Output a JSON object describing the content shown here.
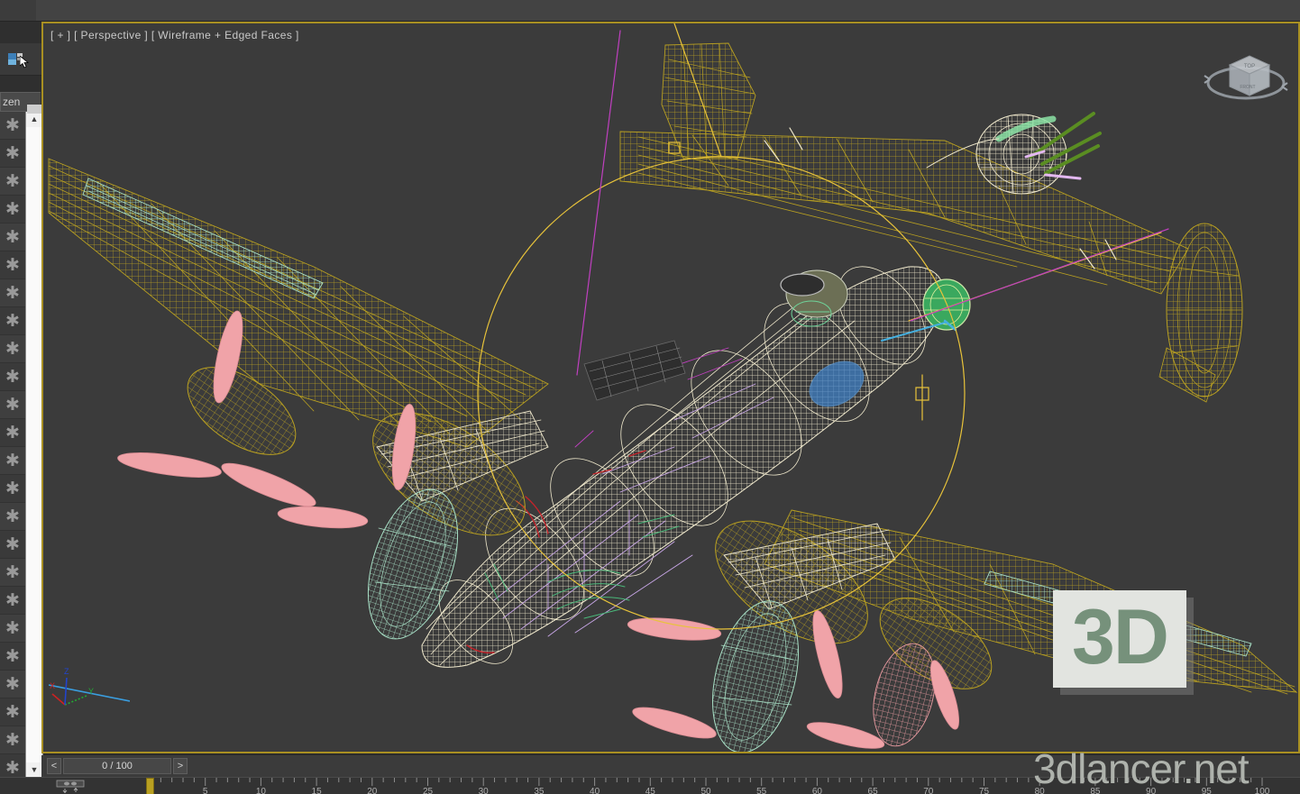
{
  "app": {
    "name": "3ds Max Viewport",
    "viewport_bg": "#3b3b3b",
    "active_border": "#a99022"
  },
  "viewport": {
    "label": "[ + ] [ Perspective ] [ Wireframe + Edged Faces ]",
    "label_parts": {
      "plus": "[ + ]",
      "view": "[ Perspective ]",
      "shading": "[ Wireframe + Edged Faces ]"
    },
    "model": "four-engine heavy bomber aircraft wireframe",
    "wireframe_colors": {
      "fuselage_yellow": "#b9a021",
      "cream": "#f0ead0",
      "mint": "#b7ecd4",
      "pink": "#f0a3a8",
      "olive": "#9b8a18",
      "purple": "#c9a7e8",
      "green": "#4ab87a",
      "red": "#c4232a",
      "magenta": "#c040c0",
      "blue": "#3f7fc4",
      "selection_yellow": "#e8c33a"
    }
  },
  "viewcube": {
    "name": "ViewCube",
    "faces": [
      "TOP",
      "FRONT"
    ],
    "ring": "navigation-ring"
  },
  "tripod": {
    "axes": [
      {
        "label": "X",
        "color": "#cc2222"
      },
      {
        "label": "Y",
        "color": "#22aa33"
      },
      {
        "label": "Z",
        "color": "#2244cc"
      }
    ],
    "grid_line_color": "#3a9ee0"
  },
  "command_panel": {
    "tool_icon": "select-object-icon",
    "cursor": "cursor-arrow-icon",
    "tab_label": "zen",
    "freeze_icon": "snowflake-freeze-icon",
    "freeze_row_count": 24,
    "scrollbar": {
      "up": "▲",
      "down": "▼"
    },
    "expand_label": "»"
  },
  "timebar": {
    "prev_label": "<",
    "next_label": ">",
    "frame_display": "0 / 100",
    "current_frame": 0,
    "total_frames": 100,
    "key_filter_icon": "key-filter-icon"
  },
  "ruler": {
    "start": 0,
    "end": 100,
    "major_step": 5,
    "labels": [
      5,
      10,
      15,
      20,
      25,
      30,
      35,
      40,
      45,
      50,
      55,
      60,
      65,
      70,
      75,
      80,
      85,
      90,
      95,
      100
    ],
    "tick_color": "#8d8d8d",
    "label_color": "#b0b0b0"
  },
  "watermark": {
    "logo_text": "3D",
    "site_text": "3dlancer.net",
    "logo_color": "#76917b",
    "card_color": "#e2e4e0",
    "site_color": "#aeb2ac"
  }
}
